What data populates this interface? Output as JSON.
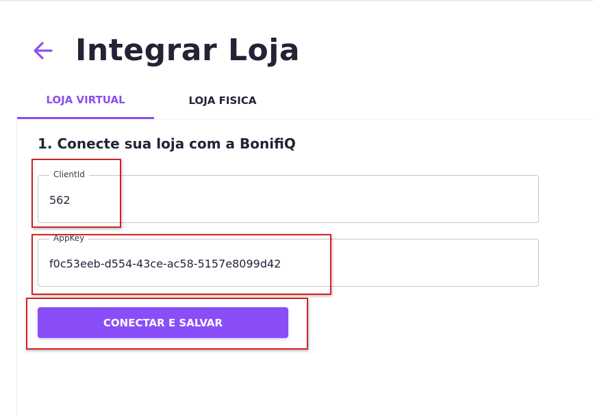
{
  "header": {
    "title": "Integrar Loja",
    "back_icon": "arrow-left-icon",
    "accent_color": "#8a4ef0"
  },
  "tabs": [
    {
      "label": "LOJA VIRTUAL",
      "active": true
    },
    {
      "label": "LOJA FISICA",
      "active": false
    }
  ],
  "section": {
    "title": "1. Conecte sua loja com a BonifiQ"
  },
  "fields": {
    "client_id": {
      "label": "ClientId",
      "value": "562"
    },
    "app_key": {
      "label": "AppKey",
      "value": "f0c53eeb-d554-43ce-ac58-5157e8099d42"
    }
  },
  "actions": {
    "submit_label": "CONECTAR E SALVAR",
    "button_color": "#8a4ef8"
  },
  "annotations": {
    "highlight_color": "#d61f1f"
  }
}
